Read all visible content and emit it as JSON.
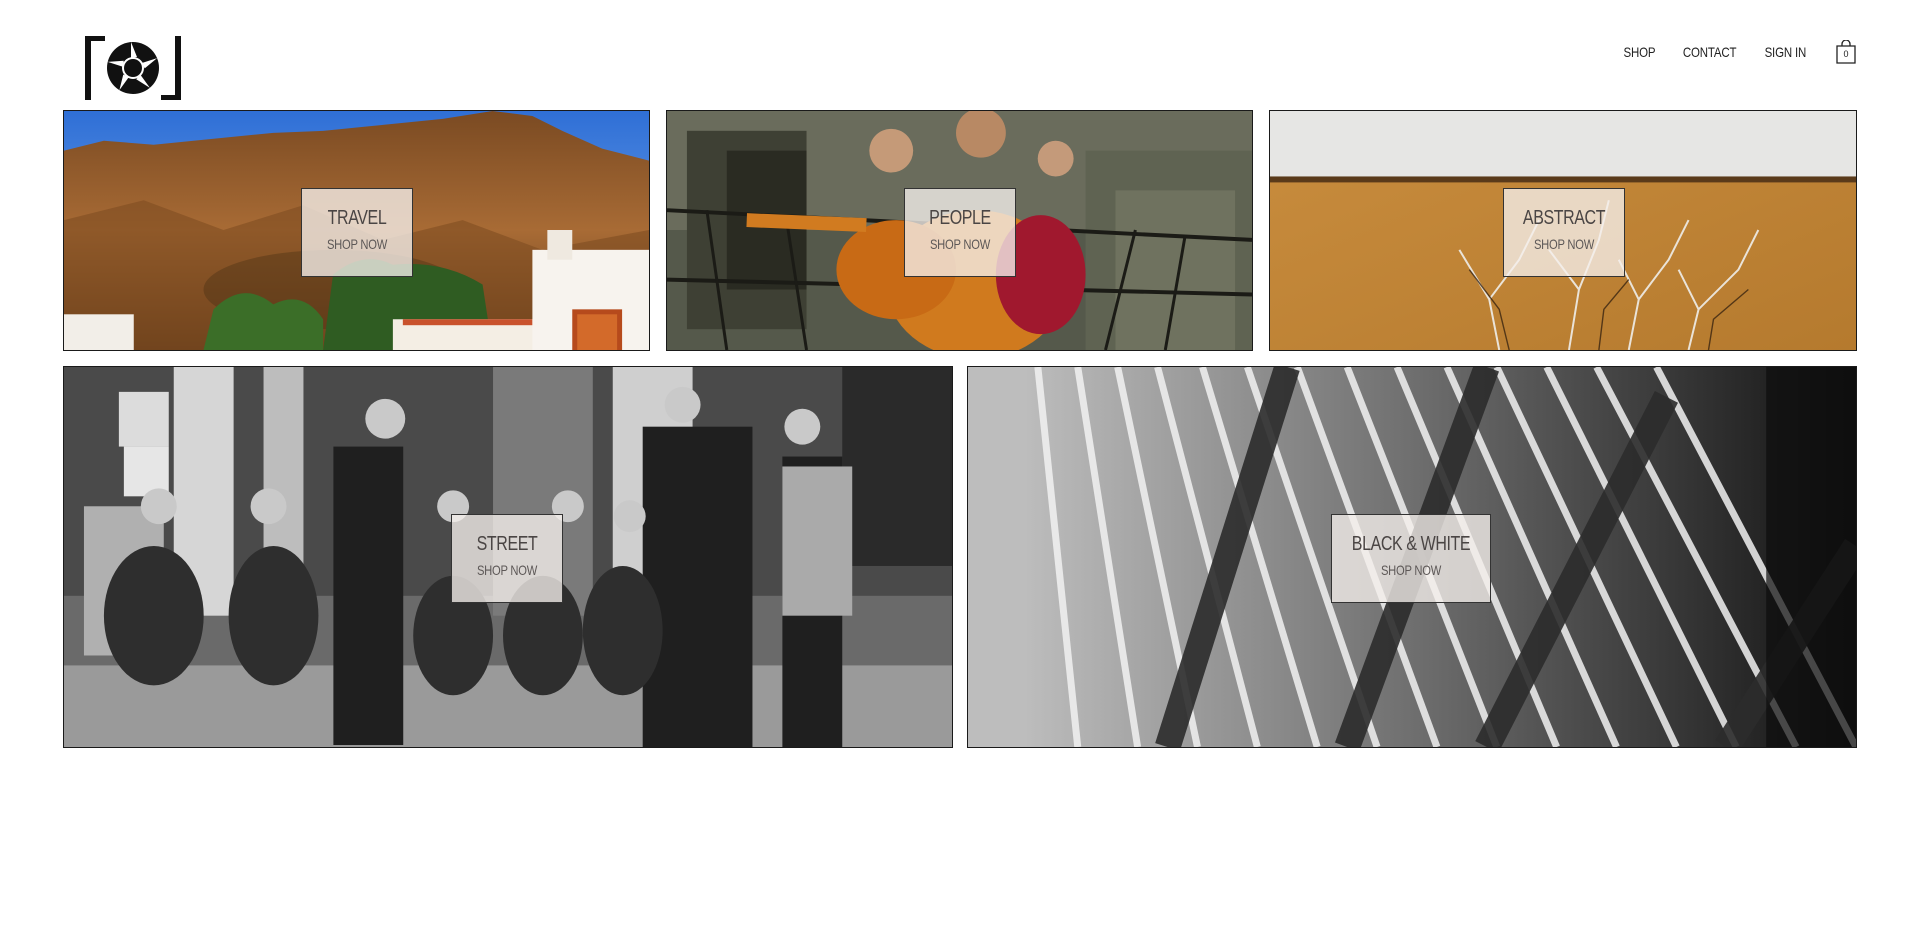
{
  "nav": {
    "links": [
      "SHOP",
      "CONTACT",
      "SIGN IN"
    ],
    "cart_count": "0",
    "logo_icon": "camera-aperture-logo",
    "cart_icon": "shopping-bag-icon"
  },
  "categories": [
    {
      "title": "TRAVEL",
      "cta": "SHOP NOW"
    },
    {
      "title": "PEOPLE",
      "cta": "SHOP NOW"
    },
    {
      "title": "ABSTRACT",
      "cta": "SHOP NOW"
    },
    {
      "title": "STREET",
      "cta": "SHOP NOW"
    },
    {
      "title": "BLACK & WHITE",
      "cta": "SHOP NOW"
    }
  ],
  "colors": {
    "text": "#222222",
    "border": "#1a1a1a",
    "label_bg": "#f5f0ec"
  }
}
